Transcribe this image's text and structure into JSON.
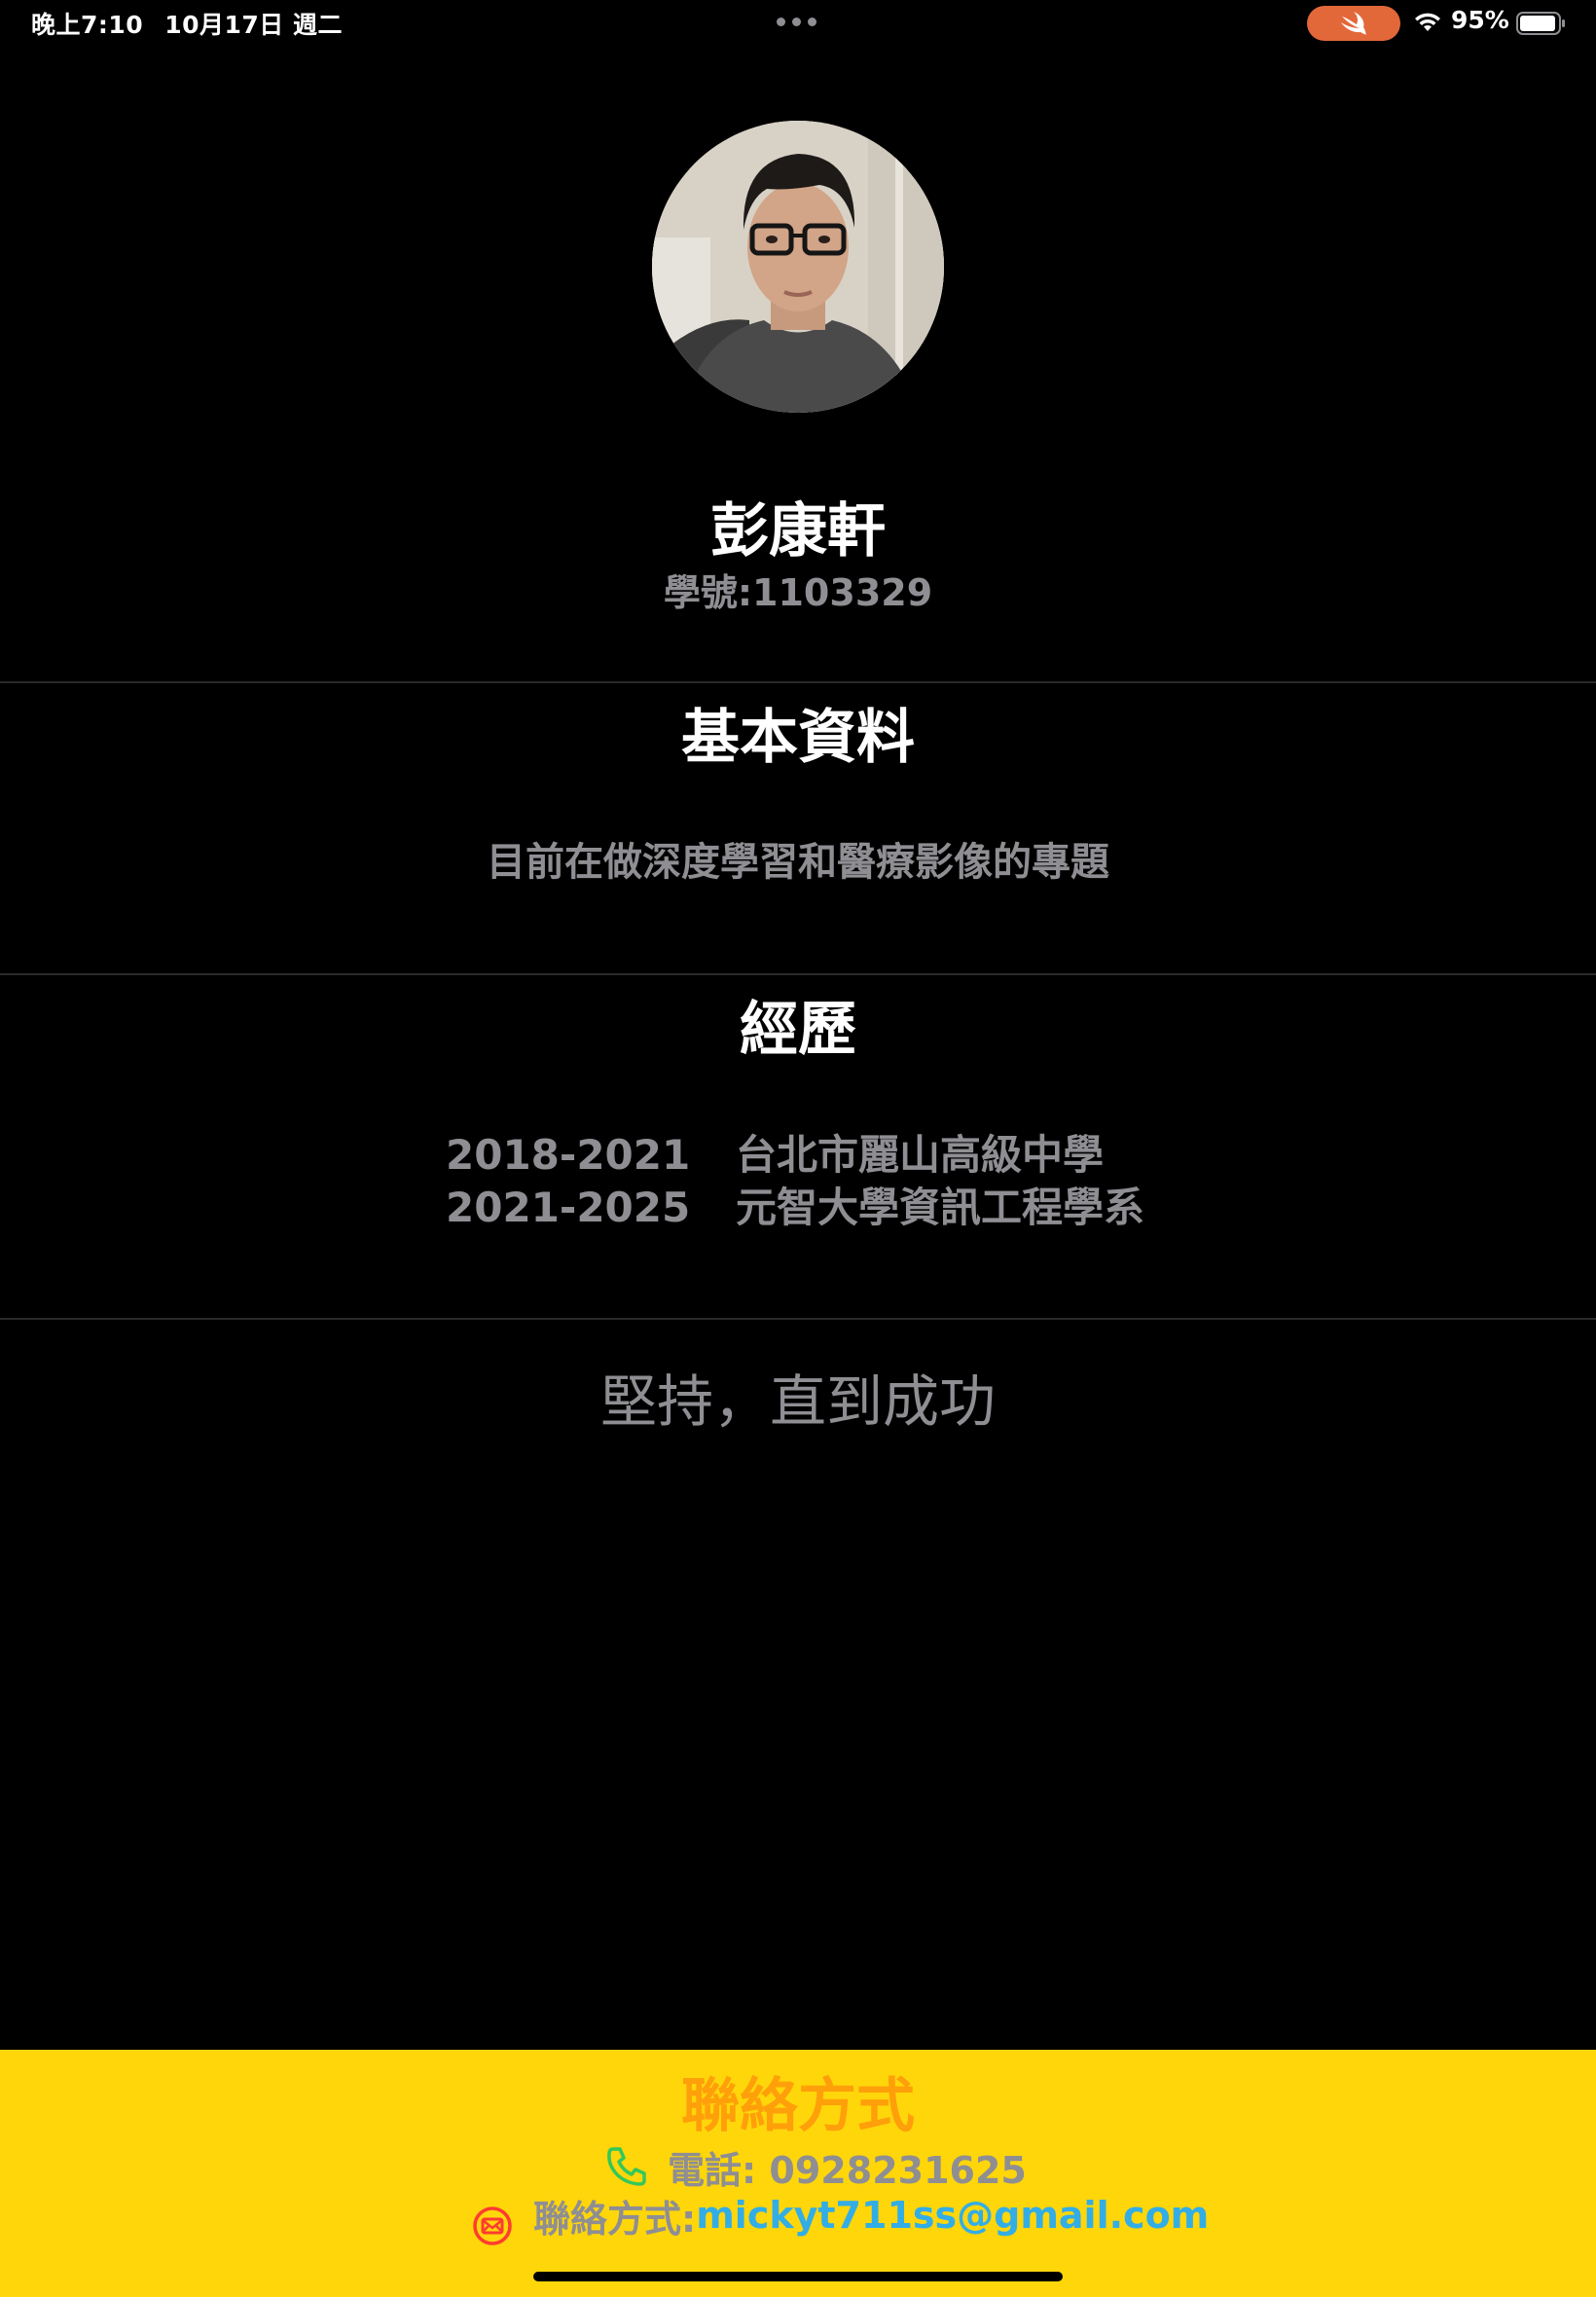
{
  "status_bar": {
    "time": "晚上7:10",
    "date": "10月17日 週二",
    "battery": "95%",
    "icons": [
      "more-dots-icon",
      "swift-icon",
      "wifi-icon",
      "battery-icon"
    ]
  },
  "profile": {
    "avatar": "profile-photo",
    "name": "彭康軒",
    "student_id": "學號:1103329"
  },
  "basic_info": {
    "title": "基本資料",
    "description": "目前在做深度學習和醫療影像的專題"
  },
  "experience": {
    "title": "經歷",
    "items": [
      {
        "years": "2018-2021",
        "school": "台北市麗山高級中學"
      },
      {
        "years": "2021-2025",
        "school": "元智大學資訊工程學系"
      }
    ]
  },
  "motto": "堅持，直到成功",
  "contact": {
    "title": "聯絡方式",
    "phone_label": "電話: 0928231625",
    "email_label": "聯絡方式: ",
    "email": "mickyt711ss@gmail.com",
    "icons": [
      "phone-icon",
      "mail-icon"
    ]
  },
  "colors": {
    "background": "#000000",
    "secondary_text": "#8e8e93",
    "contact_panel": "#ffd60a",
    "contact_title": "#ff9f0a",
    "email_link": "#32ade6",
    "phone_icon": "#34c759",
    "mail_icon": "#ff3b30",
    "swift_pill": "#e2683a"
  }
}
